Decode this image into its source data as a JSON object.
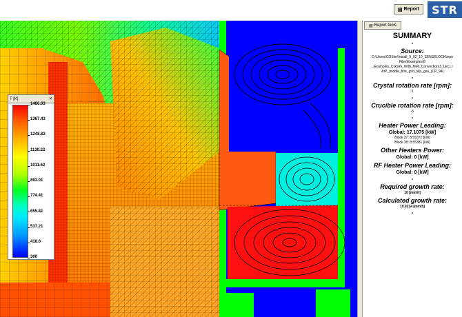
{
  "toolbar": {
    "report_label": "Report"
  },
  "logo": {
    "text": "STR"
  },
  "panel": {
    "tools_label": "Report tools",
    "summary_title": "SUMMARY",
    "source_heading": "Source:",
    "source_lines": [
      "D:\\Users\\COSim\\Install_9_02_10_SENSELOCK\\inpu",
      "Files\\Examples\\8",
      "_Examples_CGSim_With_Melt_Convection\\3_LEC_I",
      "\\InP_middle_fine_grid_slip_gas_(CP_94)"
    ],
    "crystal_heading": "Crystal rotation rate [rpm]:",
    "crystal_value": "5",
    "crucible_heading": "Crucible rotation rate [rpm]:",
    "crucible_value": "-5",
    "heater_heading": "Heater Power Leading:",
    "heater_global": "Global: 17.1075 [kW]",
    "heater_block37": "Block 37: 8.55372 [kW]",
    "heater_block38": "Block 38: 8.55381 [kW]",
    "other_heading": "Other Heaters Power:",
    "other_global": "Global: 0 [kW]",
    "rf_heading": "RF Heater Power Leading:",
    "rf_global": "Global: 0 [kW]",
    "required_heading": "Required growth rate:",
    "required_value": "10 [mm/h]",
    "calculated_heading": "Calculated growth rate:",
    "calculated_value": "10.0214 [mm/h]"
  },
  "legend": {
    "title": "T [K]",
    "close": "✕",
    "labels": [
      "1486.03",
      "1367.43",
      "1248.82",
      "1130.22",
      "1011.62",
      "893.01",
      "774.41",
      "655.81",
      "537.21",
      "418.6",
      "300"
    ]
  },
  "colors": {
    "hot": "#ff0000",
    "cold": "#0000ff",
    "panel_bg": "#ffffff",
    "logo_bg": "#2b5fa6"
  }
}
